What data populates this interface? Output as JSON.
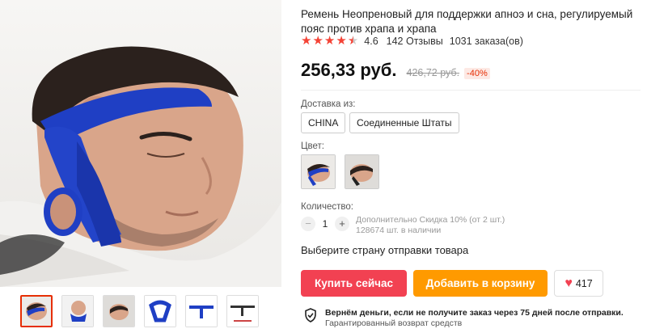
{
  "product": {
    "title": "Ремень Неопреновый для поддержки апноэ и сна, регулируемый пояс против храпа и храпа",
    "rating": "4.6",
    "reviews": "142 Отзывы",
    "orders": "1031 заказа(ов)",
    "price": "256,33 руб.",
    "old_price": "426,72 руб.",
    "discount": "-40%"
  },
  "delivery": {
    "label": "Доставка из:",
    "options": [
      "CHINA",
      "Соединенные Штаты"
    ]
  },
  "color": {
    "label": "Цвет:"
  },
  "quantity": {
    "label": "Количество:",
    "minus": "−",
    "value": "1",
    "plus": "+",
    "discount_note": "Дополнительно Скидка 10% (от 2 шт.)",
    "stock": "128674 шт. в наличии"
  },
  "shipping_prompt": "Выберите страну отправки товара",
  "actions": {
    "buy_now": "Купить сейчас",
    "add_to_cart": "Добавить в корзину",
    "wishlist_count": "417"
  },
  "guarantee": {
    "title": "Вернём деньги, если не получите заказ через 75 дней после отправки.",
    "subtitle": "Гарантированный возврат средств"
  },
  "colors": {
    "accent_red": "#f24152",
    "accent_orange": "#ff9a00",
    "strap_blue": "#1f3fc4"
  }
}
